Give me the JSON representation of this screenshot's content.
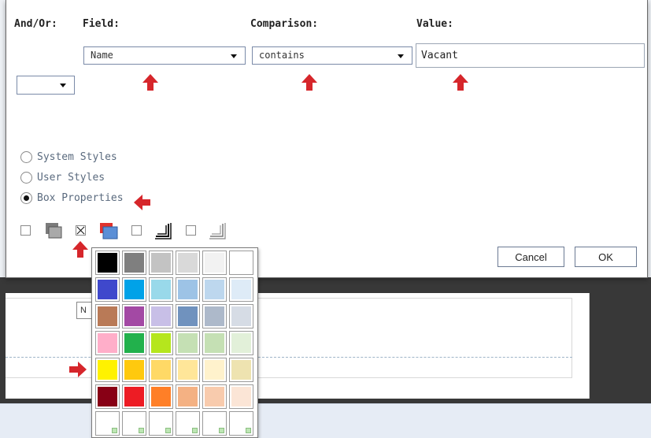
{
  "dialog": {
    "headers": {
      "and_or": "And/Or:",
      "field": "Field:",
      "comparison": "Comparison:",
      "value": "Value:"
    },
    "field_select": {
      "value": "Name"
    },
    "comparison_select": {
      "value": "contains"
    },
    "value_input": {
      "value": "Vacant"
    },
    "and_or_select": {
      "value": ""
    },
    "style_options": [
      {
        "label": "System Styles",
        "checked": false
      },
      {
        "label": "User Styles",
        "checked": false
      },
      {
        "label": "Box Properties",
        "checked": true
      }
    ],
    "box_property_toggles": [
      {
        "name": "shadow",
        "checked": false
      },
      {
        "name": "fill-color",
        "checked": true
      },
      {
        "name": "border-solid",
        "checked": false
      },
      {
        "name": "border-light",
        "checked": false
      }
    ],
    "buttons": {
      "cancel": "Cancel",
      "ok": "OK"
    }
  },
  "palette": {
    "rows": [
      [
        "#000000",
        "#7f7f7f",
        "#c3c3c3",
        "#d9d9d9",
        "#f2f2f2",
        "#ffffff"
      ],
      [
        "#3f48cc",
        "#00a2e8",
        "#99d9ea",
        "#9dc3e6",
        "#bdd7ee",
        "#deebf7"
      ],
      [
        "#b97a57",
        "#a349a4",
        "#c8bfe7",
        "#7092be",
        "#adb9ca",
        "#d6dce5"
      ],
      [
        "#ffaec9",
        "#22b14c",
        "#b5e61d",
        "#c5e0b4",
        "#c5e0b4",
        "#e2f0d9"
      ],
      [
        "#fff200",
        "#ffc90e",
        "#ffd966",
        "#ffe699",
        "#fff2cc",
        "#eee3b0"
      ],
      [
        "#880015",
        "#ed1c24",
        "#ff7f27",
        "#f4b183",
        "#f8cbad",
        "#fbe5d6"
      ],
      [
        "",
        "",
        "",
        "",
        "",
        ""
      ]
    ]
  },
  "background": {
    "mini_button_label": "N"
  },
  "colors": {
    "accent_arrow": "#d6262b",
    "dark_bg": "#383838"
  }
}
